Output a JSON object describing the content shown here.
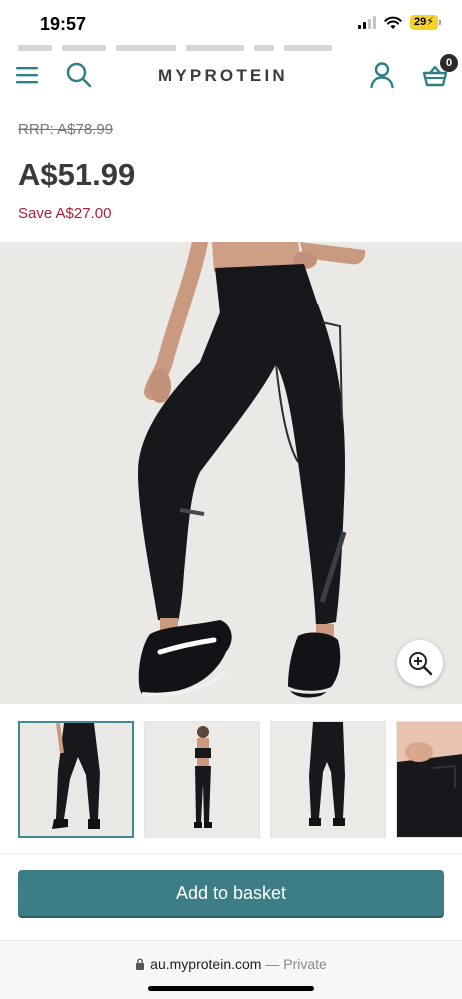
{
  "status_bar": {
    "time": "19:57",
    "battery": "29"
  },
  "header": {
    "logo": "MYPROTEIN",
    "basket_count": "0",
    "icons": [
      "menu-icon",
      "search-icon",
      "account-icon",
      "basket-icon"
    ]
  },
  "product": {
    "rrp": "RRP: A$78.99",
    "price": "A$51.99",
    "saving": "Save A$27.00"
  },
  "gallery": {
    "selected_index": 0,
    "thumbnail_count": 4,
    "zoom_icon": "zoom-in-icon"
  },
  "actions": {
    "add_to_basket": "Add to basket"
  },
  "browser": {
    "domain": "au.myprotein.com",
    "mode": "— Private"
  },
  "colors": {
    "brand_teal": "#3c7d86",
    "saving_red": "#b01d3c",
    "icon_teal": "#2f7f8a",
    "price_text": "#3a3a3a"
  }
}
